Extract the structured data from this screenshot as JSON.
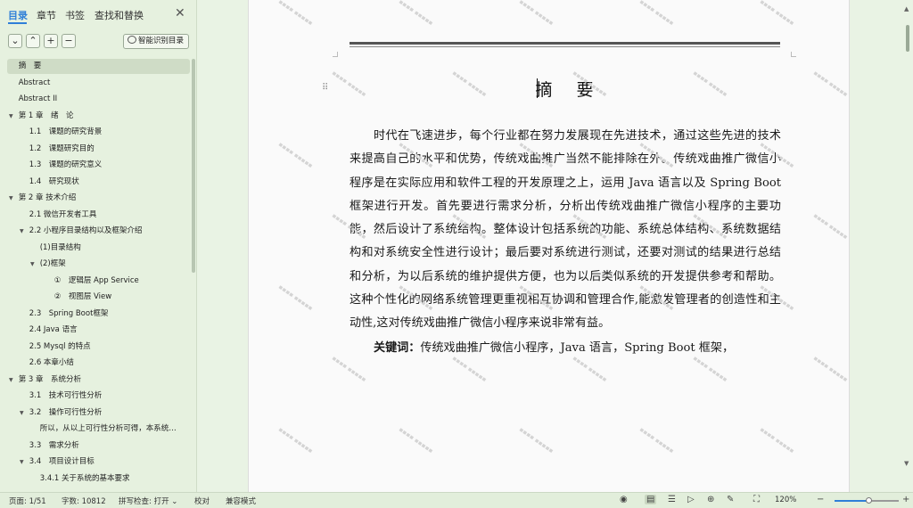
{
  "left_panel": {
    "tabs": [
      "目录",
      "章节",
      "书签",
      "查找和替换"
    ],
    "active_tab": "目录",
    "toolbar": {
      "collapse": "⌄",
      "expand": "⌃",
      "add": "+",
      "remove": "−",
      "smart_label": "智能识别目录"
    },
    "toc": [
      {
        "label": "摘　要",
        "indent": 0,
        "arrow": "",
        "selected": true
      },
      {
        "label": "Abstract",
        "indent": 0,
        "arrow": ""
      },
      {
        "label": "Abstract II",
        "indent": 0,
        "arrow": ""
      },
      {
        "label": "第 1 章　绪　论",
        "indent": 0,
        "arrow": "▼"
      },
      {
        "label": "1.1　课题的研究背景",
        "indent": 1,
        "arrow": ""
      },
      {
        "label": "1.2　课题研究目的",
        "indent": 1,
        "arrow": ""
      },
      {
        "label": "1.3　课题的研究意义",
        "indent": 1,
        "arrow": ""
      },
      {
        "label": "1.4　研究现状",
        "indent": 1,
        "arrow": ""
      },
      {
        "label": "第 2 章 技术介绍",
        "indent": 0,
        "arrow": "▼"
      },
      {
        "label": "2.1 微信开发者工具",
        "indent": 1,
        "arrow": ""
      },
      {
        "label": "2.2 小程序目录结构以及框架介绍",
        "indent": 1,
        "arrow": "▼"
      },
      {
        "label": "(1)目录结构",
        "indent": 2,
        "arrow": ""
      },
      {
        "label": "(2)框架",
        "indent": 2,
        "arrow": "▼"
      },
      {
        "label": "①　逻辑层 App Service",
        "indent": 3,
        "arrow": ""
      },
      {
        "label": "②　视图层 View",
        "indent": 3,
        "arrow": ""
      },
      {
        "label": "2.3　Spring Boot框架",
        "indent": 1,
        "arrow": ""
      },
      {
        "label": "2.4 Java 语言",
        "indent": 1,
        "arrow": ""
      },
      {
        "label": "2.5 Mysql 的特点",
        "indent": 1,
        "arrow": ""
      },
      {
        "label": "2.6 本章小结",
        "indent": 1,
        "arrow": ""
      },
      {
        "label": "第 3 章　系统分析",
        "indent": 0,
        "arrow": "▼"
      },
      {
        "label": "3.1　技术可行性分析",
        "indent": 1,
        "arrow": ""
      },
      {
        "label": "3.2　操作可行性分析",
        "indent": 1,
        "arrow": "▼"
      },
      {
        "label": "所以，从以上可行性分析可得，本系统…",
        "indent": 2,
        "arrow": ""
      },
      {
        "label": "3.3　需求分析",
        "indent": 1,
        "arrow": ""
      },
      {
        "label": "3.4　项目设计目标",
        "indent": 1,
        "arrow": "▼"
      },
      {
        "label": "3.4.1 关于系统的基本要求",
        "indent": 2,
        "arrow": ""
      }
    ]
  },
  "document": {
    "title": "摘　要",
    "abstract": "时代在飞速进步，每个行业都在努力发展现在先进技术，通过这些先进的技术来提高自己的水平和优势，传统戏曲推广当然不能排除在外。传统戏曲推广微信小程序是在实际应用和软件工程的开发原理之上，运用 Java 语言以及 Spring Boot 框架进行开发。首先要进行需求分析，分析出传统戏曲推广微信小程序的主要功能，然后设计了系统结构。整体设计包括系统的功能、系统总体结构、系统数据结构和对系统安全性进行设计；最后要对系统进行测试，还要对测试的结果进行总结和分析，为以后系统的维护提供方便，也为以后类似系统的开发提供参考和帮助。这种个性化的网络系统管理更重视相互协调和管理合作,能激发管理者的创造性和主动性,这对传统戏曲推广微信小程序来说非常有益。",
    "keywords_label": "关键词：",
    "keywords": "传统戏曲推广微信小程序，Java 语言，Spring Boot 框架，"
  },
  "status_bar": {
    "page": "页面: 1/51",
    "words": "字数: 10812",
    "spell": "拼写检查: 打开 ⌄",
    "proof": "校对",
    "compat": "兼容模式",
    "zoom": "120%",
    "zoom_fraction": 0.5
  }
}
